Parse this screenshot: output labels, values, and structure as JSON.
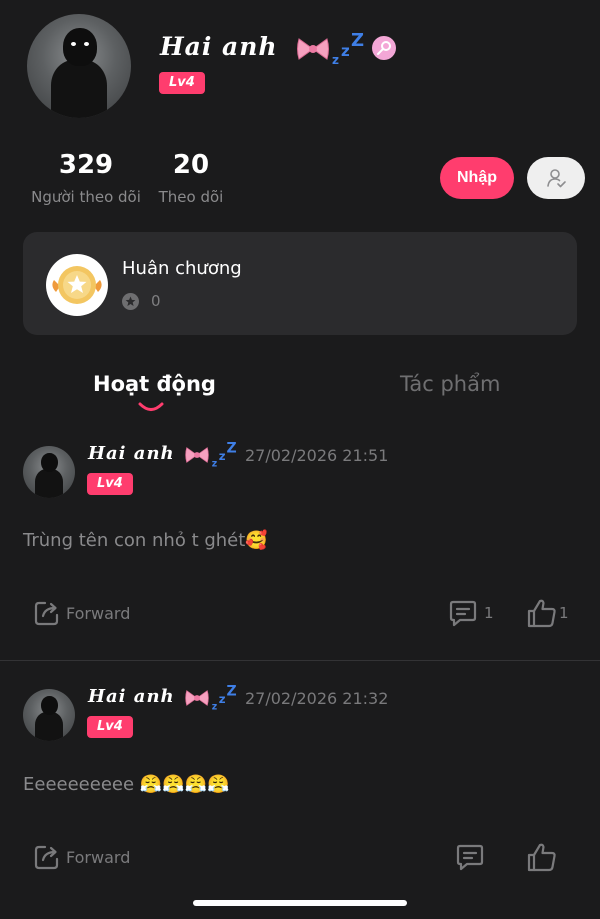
{
  "profile": {
    "name": "Hai anh",
    "level": "Lv4",
    "followers_count": "329",
    "followers_label": "Người theo dõi",
    "following_count": "20",
    "following_label": "Theo dõi",
    "follow_button_label": "Nhập"
  },
  "medal": {
    "title": "Huân chương",
    "count": "0"
  },
  "tabs": [
    {
      "label": "Hoạt động",
      "active": true
    },
    {
      "label": "Tác phẩm",
      "active": false
    }
  ],
  "posts": [
    {
      "author": "Hai anh",
      "level": "Lv4",
      "time": "27/02/2026 21:51",
      "text": "Trùng tên con nhỏ t ghét🥰",
      "forward_label": "Forward",
      "comments": "1",
      "likes": "1"
    },
    {
      "author": "Hai anh",
      "level": "Lv4",
      "time": "27/02/2026 21:32",
      "text": "Eeeeeeeeee 😤😤😤😤",
      "forward_label": "Forward",
      "comments": "",
      "likes": ""
    }
  ],
  "colors": {
    "background": "#1b1b1c",
    "accent": "#ff3d6e",
    "card": "#2b2b2d",
    "muted_text": "#8a8a8c"
  }
}
